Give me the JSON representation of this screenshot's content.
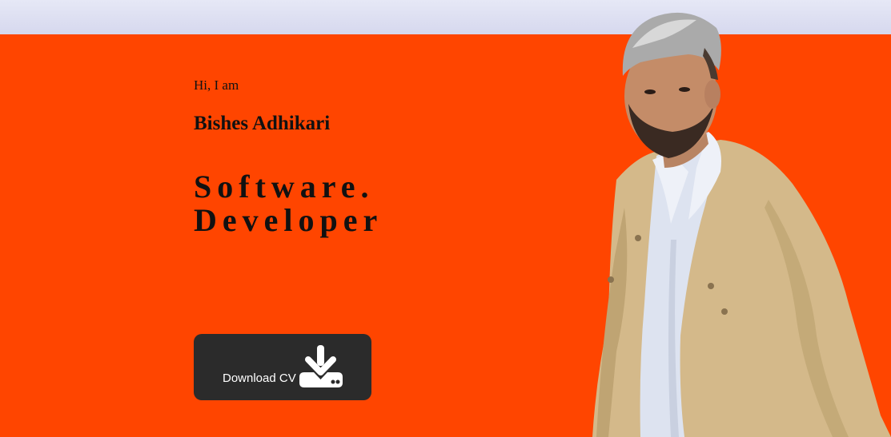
{
  "hero": {
    "greeting": "Hi, I am",
    "name": "Bishes Adhikari",
    "role_line1": "Software.",
    "role_line2": "Developer",
    "cv_button_label": "Download CV"
  },
  "icons": {
    "download": "download-icon"
  },
  "colors": {
    "background": "#ff4500",
    "button": "#2b2b2b",
    "topbar": "#dfe1f2",
    "jacket": "#d4b98a"
  }
}
